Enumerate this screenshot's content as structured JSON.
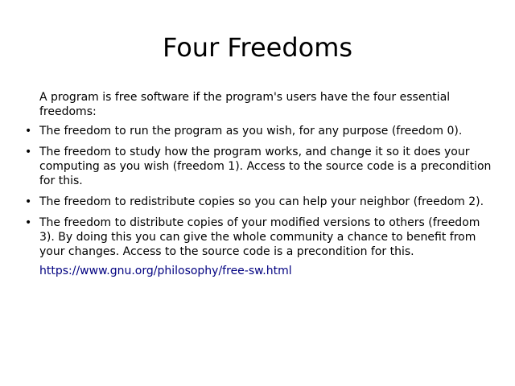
{
  "slide": {
    "title": "Four Freedoms",
    "intro": "A program is free software if the program's users have the four essential freedoms:",
    "bullet_glyph": "•",
    "items": [
      "The freedom to run the program as you wish, for any purpose (freedom 0).",
      "The freedom to study how the program works, and change it so it does your computing as you wish (freedom 1). Access to the source code is a precondition for this.",
      "The freedom to redistribute copies so you can help your neighbor (freedom 2).",
      "The freedom to distribute copies of your modified versions to others (freedom 3). By doing this you can give the whole community a chance to benefit from your changes. Access to the source code is a precondition for this."
    ],
    "link_text": "https://www.gnu.org/philosophy/free-sw.html",
    "link_color": "#000080"
  }
}
